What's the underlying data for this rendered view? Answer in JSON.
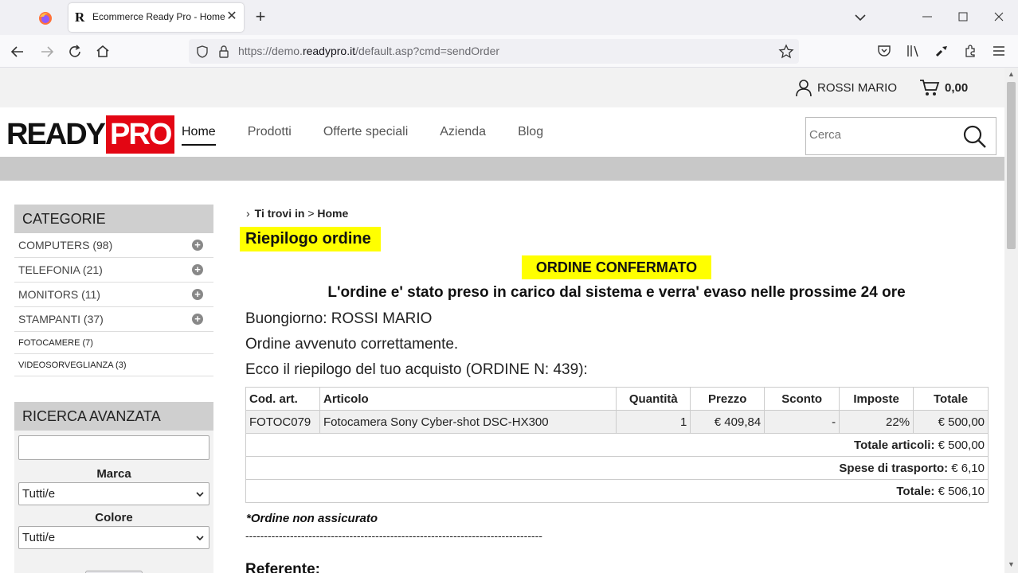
{
  "browser": {
    "tab_title": "Ecommerce Ready Pro - Home",
    "favicon_letter": "R",
    "url_prefix": "https://demo.",
    "url_domain": "readypro.it",
    "url_path": "/default.asp?cmd=sendOrder",
    "accent": "#e30613"
  },
  "topbar": {
    "user_name": "ROSSI MARIO",
    "cart_total": "0,00"
  },
  "header": {
    "logo_ready": "READY",
    "logo_pro": "PRO",
    "menu": [
      {
        "label": "Home"
      },
      {
        "label": "Prodotti"
      },
      {
        "label": "Offerte speciali"
      },
      {
        "label": "Azienda"
      },
      {
        "label": "Blog"
      }
    ],
    "search_placeholder": "Cerca"
  },
  "sidebar": {
    "categories_title": "CATEGORIE",
    "categories": [
      {
        "label": "COMPUTERS (98)"
      },
      {
        "label": "TELEFONIA (21)"
      },
      {
        "label": "MONITORS (11)"
      },
      {
        "label": "STAMPANTI (37)"
      },
      {
        "label": "FOTOCAMERE (7)"
      },
      {
        "label": "VIDEOSORVEGLIANZA (3)"
      }
    ],
    "advanced_title": "RICERCA AVANZATA",
    "brand_label": "Marca",
    "brand_value": "Tutti/e",
    "color_label": "Colore",
    "color_value": "Tutti/e"
  },
  "content": {
    "breadcrumb_you_are": "Ti trovi in",
    "breadcrumb_sep": ">",
    "breadcrumb_home": "Home",
    "title": "Riepilogo ordine",
    "confirmed": "ORDINE CONFERMATO",
    "notice": "L'ordine e' stato preso in carico dal sistema e verra' evaso nelle prossime 24 ore",
    "greeting": "Buongiorno: ROSSI MARIO",
    "success": "Ordine avvenuto correttamente.",
    "summary_intro": "Ecco il riepilogo del tuo acquisto (ORDINE N: 439):",
    "table": {
      "headers": {
        "code": "Cod. art.",
        "article": "Articolo",
        "qty": "Quantità",
        "price": "Prezzo",
        "discount": "Sconto",
        "tax": "Imposte",
        "total": "Totale"
      },
      "row": {
        "code": "FOTOC079",
        "article": "Fotocamera Sony Cyber-shot DSC-HX300",
        "qty": "1",
        "price": "€ 409,84",
        "discount": "-",
        "tax": "22%",
        "total": "€ 500,00"
      },
      "items_total_label": "Totale articoli:",
      "items_total_value": "€ 500,00",
      "shipping_label": "Spese di trasporto:",
      "shipping_value": "€ 6,10",
      "grand_total_label": "Totale:",
      "grand_total_value": "€ 506,10"
    },
    "not_insured": "*Ordine non assicurato",
    "dashes": "--------------------------------------------------------------------------------",
    "referente": "Referente:"
  }
}
